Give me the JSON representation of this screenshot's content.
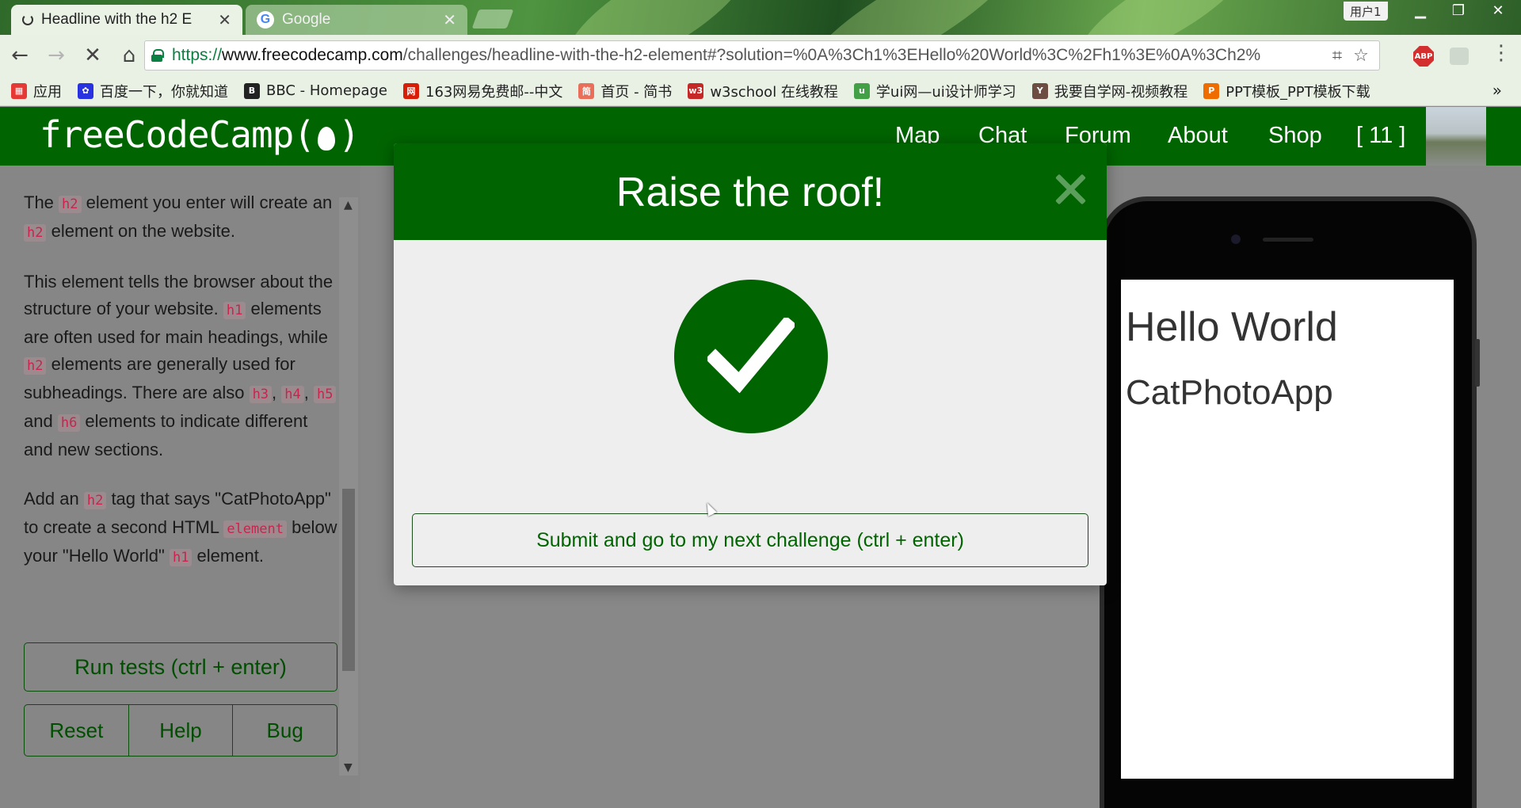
{
  "browser": {
    "tabs": [
      {
        "title": "Headline with the h2 E",
        "active": true
      },
      {
        "title": "Google",
        "active": false
      }
    ],
    "user_badge": "用户1",
    "url": {
      "scheme": "https://",
      "host": "www.freecodecamp.com",
      "path": "/challenges/headline-with-the-h2-element#?solution=%0A%3Ch1%3EHello%20World%3C%2Fh1%3E%0A%3Ch2%"
    },
    "bookmarks": [
      {
        "label": "应用",
        "icon": "apps-grid-icon",
        "color": "#e53935"
      },
      {
        "label": "百度一下，你就知道",
        "icon": "baidu-paw-icon",
        "color": "#2932e1"
      },
      {
        "label": "BBC - Homepage",
        "icon": "bbc-icon",
        "color": "#222222"
      },
      {
        "label": "163网易免费邮--中文",
        "icon": "netease-icon",
        "color": "#d81e06"
      },
      {
        "label": "首页 - 简书",
        "icon": "jianshu-icon",
        "color": "#ea6f5a"
      },
      {
        "label": "w3school 在线教程",
        "icon": "w3school-icon",
        "color": "#c62828"
      },
      {
        "label": "学ui网—ui设计师学习",
        "icon": "xueui-icon",
        "color": "#43a047"
      },
      {
        "label": "我要自学网-视频教程",
        "icon": "51zxw-icon",
        "color": "#6d4c41"
      },
      {
        "label": "PPT模板_PPT模板下载",
        "icon": "ppt-icon",
        "color": "#ef6c00"
      }
    ],
    "bookmarks_more": "»"
  },
  "fcc": {
    "logo": "freeCodeCamp",
    "logo_open": "(",
    "logo_close": ")",
    "nav": [
      "Map",
      "Chat",
      "Forum",
      "About",
      "Shop",
      "[ 11 ]"
    ]
  },
  "instructions": {
    "p1": {
      "t1": "The ",
      "c1": "h2",
      "t2": " element you enter will create an ",
      "c2": "h2",
      "t3": " element on the website."
    },
    "p2": {
      "t1": "This element tells the browser about the structure of your website. ",
      "c1": "h1",
      "t2": " elements are often used for main headings, while ",
      "c2": "h2",
      "t3": " elements are generally used for subheadings. There are also ",
      "c3": "h3",
      "t4": ", ",
      "c4": "h4",
      "t5": ", ",
      "c5": "h5",
      "t6": " and ",
      "c6": "h6",
      "t7": " elements to indicate different and new sections."
    },
    "p3": {
      "t1": "Add an ",
      "c1": "h2",
      "t2": " tag that says \"CatPhotoApp\" to create a second HTML ",
      "c2": "element",
      "t3": " below your \"Hello World\" ",
      "c3": "h1",
      "t4": " element."
    }
  },
  "buttons": {
    "run": "Run tests (ctrl + enter)",
    "reset": "Reset",
    "help": "Help",
    "bug": "Bug"
  },
  "preview": {
    "h1": "Hello World",
    "h2": "CatPhotoApp"
  },
  "modal": {
    "title": "Raise the roof!",
    "submit": "Submit and go to my next challenge (ctrl + enter)"
  },
  "colors": {
    "fcc_green": "#006400",
    "code_red": "#c7254e"
  }
}
